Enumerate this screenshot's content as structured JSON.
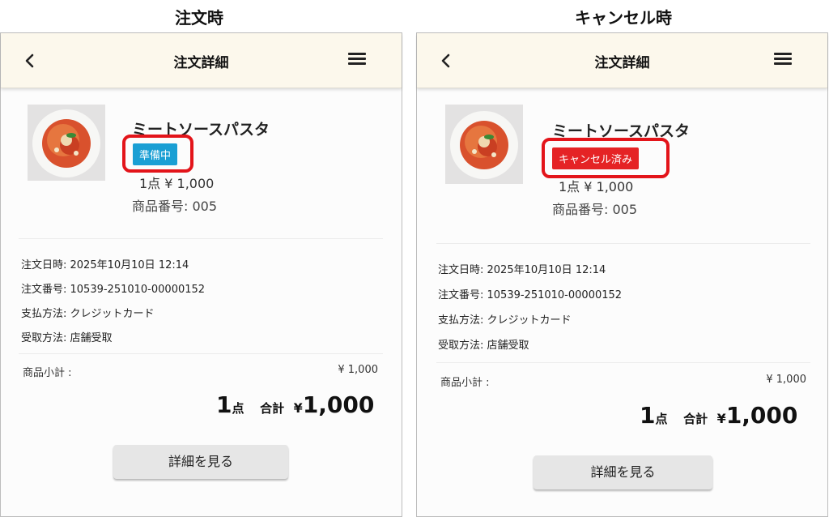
{
  "captions": {
    "left": "注文時",
    "right": "キャンセル時"
  },
  "header": {
    "title": "注文詳細"
  },
  "product": {
    "name": "ミートソースパスタ",
    "quantity_price": "1点 ¥ 1,000",
    "code": "商品番号: 005"
  },
  "status": {
    "preparing": "準備中",
    "cancelled": "キャンセル済み"
  },
  "order": {
    "date": "注文日時: 2025年10月10日 12:14",
    "number": "注文番号: 10539-251010-00000152",
    "payment": "支払方法: クレジットカード",
    "pickup": "受取方法: 店舗受取"
  },
  "summary": {
    "subtotal_label": "商品小計 :",
    "subtotal_value": "¥ 1,000",
    "count": "1",
    "count_unit": "点",
    "total_label": "合計",
    "currency": "¥",
    "total_value": "1,000"
  },
  "button": {
    "details": "詳細を見る"
  },
  "icons": {
    "back": "chevron-left-icon",
    "menu": "hamburger-menu-icon",
    "image": "pasta-photo"
  },
  "colors": {
    "header_bg": "#fcf8ec",
    "badge_preparing": "#1a9fd4",
    "badge_cancelled": "#e52325",
    "highlight": "#e3141a"
  }
}
